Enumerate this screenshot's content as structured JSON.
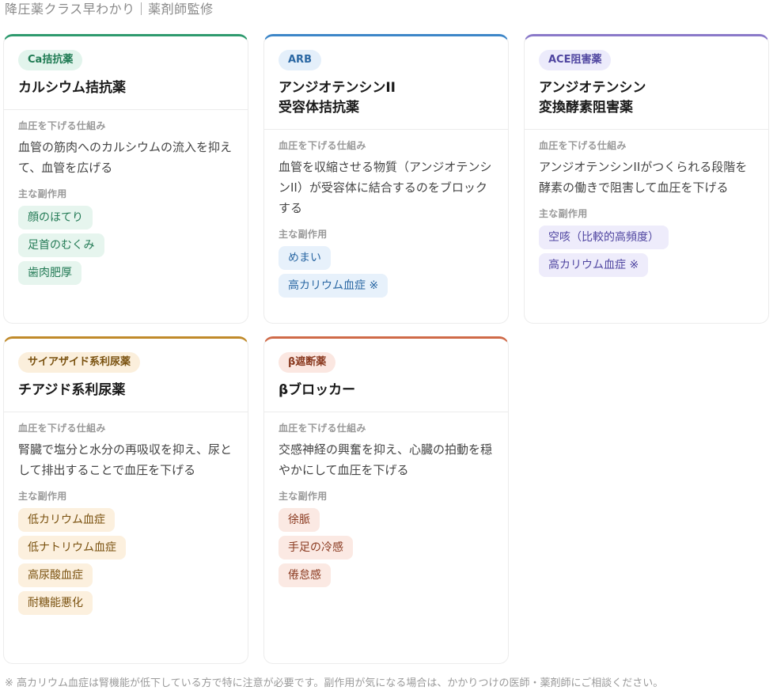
{
  "page": {
    "title": "降圧薬クラス早わかり｜薬剤師監修",
    "footnote": "※ 高カリウム血症は腎機能が低下している方で特に注意が必要です。副作用が気になる場合は、かかりつけの医師・薬剤師にご相談ください。"
  },
  "labels": {
    "mechanism": "血圧を下げる仕組み",
    "side_effects": "主な副作用"
  },
  "cards": [
    {
      "badge": "Ca拮抗薬",
      "title": "カルシウム拮抗薬",
      "mechanism": "血管の筋肉へのカルシウムの流入を抑えて、血管を広げる",
      "side_effects": [
        "顔のほてり",
        "足首のむくみ",
        "歯肉肥厚"
      ],
      "accent": "#2e9a6e",
      "badge_bg": "#e2f4ec",
      "badge_fg": "#1e7a52",
      "tag_bg": "#e6f5ee",
      "tag_fg": "#237a55"
    },
    {
      "badge": "ARB",
      "title": "アンジオテンシンII\n受容体拮抗薬",
      "mechanism": "血管を収縮させる物質（アンジオテンシンII）が受容体に結合するのをブロックする",
      "side_effects": [
        "めまい",
        "高カリウム血症 ※"
      ],
      "accent": "#3d86c8",
      "badge_bg": "#e4effa",
      "badge_fg": "#2a67a3",
      "tag_bg": "#e7f1fb",
      "tag_fg": "#2a67a3"
    },
    {
      "badge": "ACE阻害薬",
      "title": "アンジオテンシン\n変換酵素阻害薬",
      "mechanism": "アンジオテンシンIIがつくられる段階を酵素の働きで阻害して血圧を下げる",
      "side_effects": [
        "空咳（比較的高頻度）",
        "高カリウム血症 ※"
      ],
      "accent": "#8a79c9",
      "badge_bg": "#ecebfb",
      "badge_fg": "#4f45a0",
      "tag_bg": "#eeecfb",
      "tag_fg": "#4f45a0"
    },
    {
      "badge": "サイアザイド系利尿薬",
      "title": "チアジド系利尿薬",
      "mechanism": "腎臓で塩分と水分の再吸収を抑え、尿として排出することで血圧を下げる",
      "side_effects": [
        "低カリウム血症",
        "低ナトリウム血症",
        "高尿酸血症",
        "耐糖能悪化"
      ],
      "accent": "#c08a2a",
      "badge_bg": "#fbefdc",
      "badge_fg": "#7a5210",
      "tag_bg": "#fcf0de",
      "tag_fg": "#7a5210"
    },
    {
      "badge": "β遮断薬",
      "title": "βブロッカー",
      "mechanism": "交感神経の興奮を抑え、心臓の拍動を穏やかにして血圧を下げる",
      "side_effects": [
        "徐脈",
        "手足の冷感",
        "倦怠感"
      ],
      "accent": "#cf6a48",
      "badge_bg": "#fbe7e1",
      "badge_fg": "#8a3a20",
      "tag_bg": "#fbe9e3",
      "tag_fg": "#8a3a20"
    }
  ]
}
